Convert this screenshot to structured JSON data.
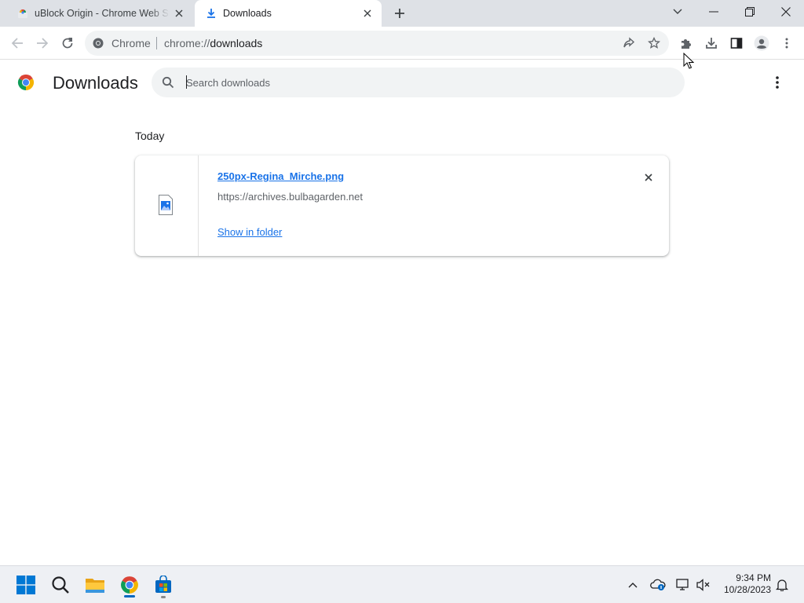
{
  "browser": {
    "tabs": [
      {
        "title": "uBlock Origin - Chrome Web Store",
        "favicon": "chrome-web-store-icon",
        "active": false
      },
      {
        "title": "Downloads",
        "favicon": "download-icon",
        "active": true
      }
    ],
    "omnibox": {
      "chip": "Chrome",
      "url_scheme": "chrome://",
      "url_host": "downloads"
    }
  },
  "page": {
    "title": "Downloads",
    "search": {
      "placeholder": "Search downloads",
      "value": ""
    },
    "section_date": "Today",
    "downloads": [
      {
        "file_name": "250px-Regina_Mirche.png",
        "source_url": "https://archives.bulbagarden.net",
        "action_label": "Show in folder"
      }
    ]
  },
  "taskbar": {
    "apps": [
      "start-icon",
      "search-icon",
      "file-explorer-icon",
      "chrome-icon",
      "store-icon"
    ],
    "clock_time": "9:34 PM",
    "clock_date": "10/28/2023"
  },
  "colors": {
    "accent": "#1a73e8",
    "tabstrip_bg": "#dee1e6",
    "omnibox_bg": "#f1f3f4",
    "taskbar_bg": "#eef0f4"
  }
}
